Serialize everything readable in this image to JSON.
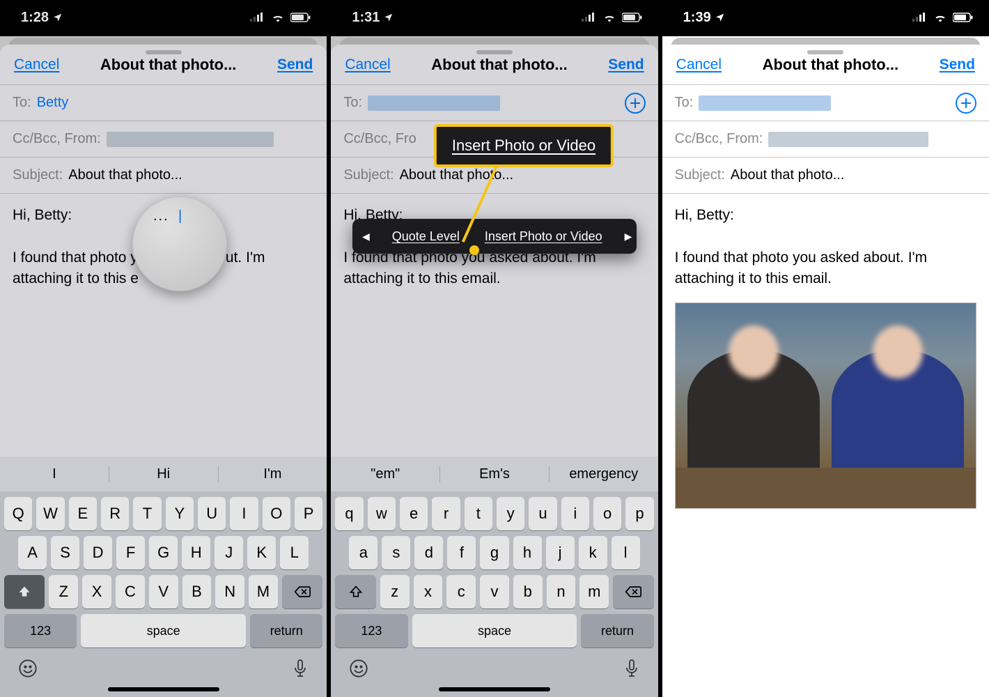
{
  "statusbar": {
    "t1": "1:28",
    "t2": "1:31",
    "t3": "1:39"
  },
  "nav": {
    "cancel": "Cancel",
    "title": "About that photo...",
    "send": "Send"
  },
  "fields": {
    "to_label": "To:",
    "to_value": "Betty",
    "ccbcc_label": "Cc/Bcc, From:",
    "ccbcc_short": "Cc/Bcc, Fro",
    "subject_label": "Subject:",
    "subject_value": "About that photo..."
  },
  "body": {
    "greeting": "Hi, Betty:",
    "line_full": "I found that photo you asked about. I'm attaching it to this email.",
    "line_p1_a": "I found that photo y",
    "line_p1_b": "ut. I'm attaching it to this e"
  },
  "editmenu": {
    "prev": "◀",
    "item1": "Quote Level",
    "item2": "Insert Photo or Video",
    "next": "▶"
  },
  "callout": {
    "text": "Insert Photo or Video"
  },
  "keyboard": {
    "suggest1": [
      "I",
      "Hi",
      "I'm"
    ],
    "suggest2": [
      "\"em\"",
      "Em's",
      "emergency"
    ],
    "row1_upper": [
      "Q",
      "W",
      "E",
      "R",
      "T",
      "Y",
      "U",
      "I",
      "O",
      "P"
    ],
    "row2_upper": [
      "A",
      "S",
      "D",
      "F",
      "G",
      "H",
      "J",
      "K",
      "L"
    ],
    "row3_upper": [
      "Z",
      "X",
      "C",
      "V",
      "B",
      "N",
      "M"
    ],
    "row1_lower": [
      "q",
      "w",
      "e",
      "r",
      "t",
      "y",
      "u",
      "i",
      "o",
      "p"
    ],
    "row2_lower": [
      "a",
      "s",
      "d",
      "f",
      "g",
      "h",
      "j",
      "k",
      "l"
    ],
    "row3_lower": [
      "z",
      "x",
      "c",
      "v",
      "b",
      "n",
      "m"
    ],
    "numkey": "123",
    "space": "space",
    "ret": "return"
  }
}
